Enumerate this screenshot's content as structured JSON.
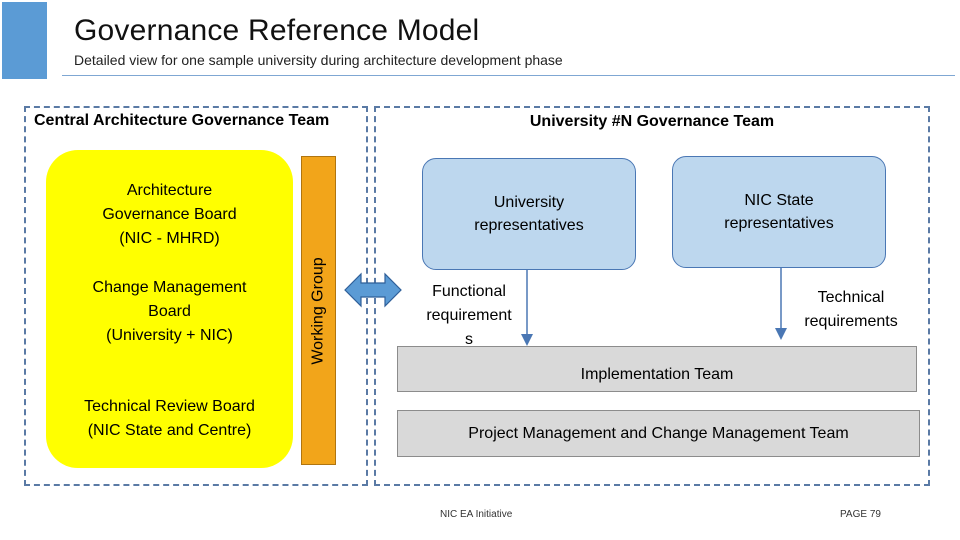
{
  "header": {
    "title": "Governance Reference Model",
    "subtitle": "Detailed view for one sample university during architecture development phase"
  },
  "central": {
    "label": "Central Architecture Governance Team",
    "boards": [
      "Architecture\nGovernance Board\n(NIC - MHRD)",
      "Change Management\nBoard\n(University + NIC)",
      "Technical Review Board\n(NIC State and Centre)"
    ],
    "working_group": "Working Group"
  },
  "university": {
    "label": "University #N Governance Team",
    "university_reps": "University\nrepresentatives",
    "nic_state_reps": "NIC State\nrepresentatives",
    "functional_req": "Functional\nrequirement\ns",
    "technical_req": "Technical\nrequirements",
    "implementation_team": "Implementation Team",
    "pm_team": "Project Management and Change Management Team"
  },
  "footer": {
    "left": "NIC EA Initiative",
    "right": "PAGE 79"
  },
  "colors": {
    "accent": "#5b9bd5",
    "yellow": "#ffff00",
    "working_group": "#f2a51a",
    "blue_box": "#bdd7ee",
    "grey_box": "#d9d9d9",
    "dashed_border": "#5a7aa5"
  }
}
